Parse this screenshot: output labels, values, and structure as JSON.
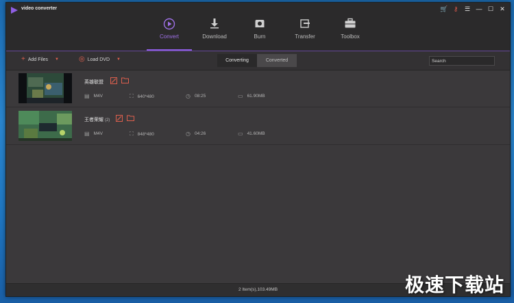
{
  "app": {
    "title": "video converter"
  },
  "nav": [
    {
      "label": "Convert",
      "icon": "convert-icon",
      "active": true
    },
    {
      "label": "Download",
      "icon": "download-icon"
    },
    {
      "label": "Burn",
      "icon": "burn-icon"
    },
    {
      "label": "Transfer",
      "icon": "transfer-icon"
    },
    {
      "label": "Toolbox",
      "icon": "toolbox-icon"
    }
  ],
  "toolbar": {
    "add_files": "Add Files",
    "load_dvd": "Load DVD"
  },
  "tabs": {
    "converting": "Converting",
    "converted": "Converted"
  },
  "search": {
    "placeholder": "Search"
  },
  "files": [
    {
      "name": "英雄联盟",
      "format": "M4V",
      "resolution": "640*480",
      "duration": "08:25",
      "size": "61.90MB"
    },
    {
      "name": "王者荣耀",
      "suffix": "(2)",
      "format": "M4V",
      "resolution": "848*480",
      "duration": "04:26",
      "size": "41.60MB"
    }
  ],
  "status": {
    "summary": "2 Item(s),103.49MB"
  },
  "watermark": "极速下载站",
  "colors": {
    "accent": "#8e5ee0",
    "icon_red": "#e0604e"
  }
}
